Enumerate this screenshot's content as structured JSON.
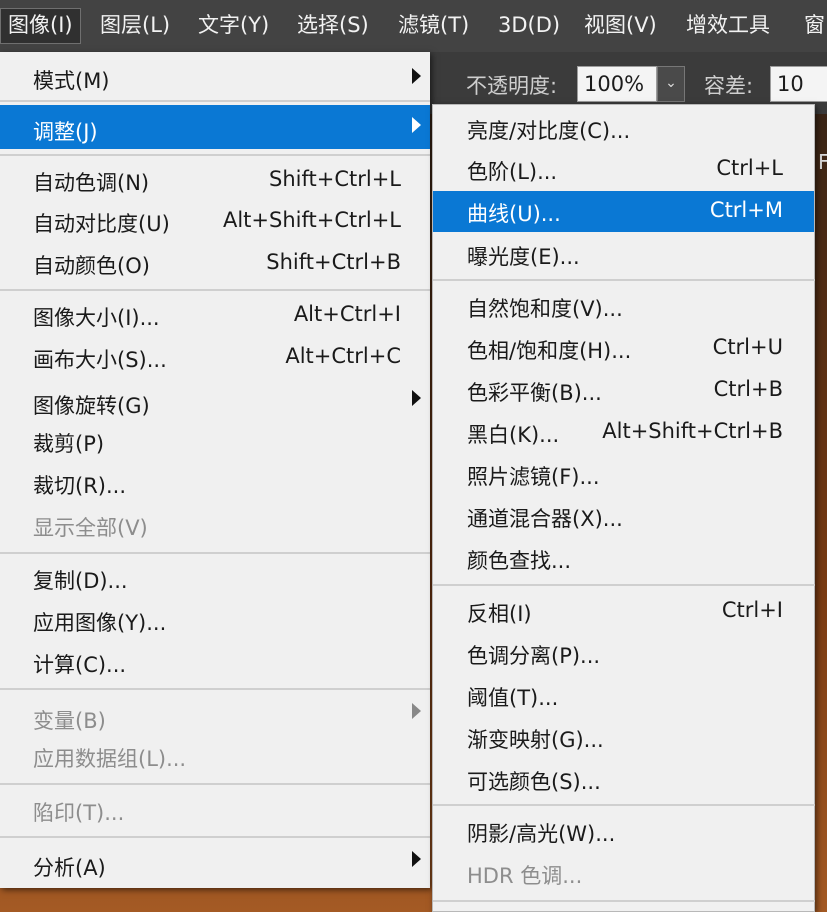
{
  "menubar": {
    "items": [
      "图像(I)",
      "图层(L)",
      "文字(Y)",
      "选择(S)",
      "滤镜(T)",
      "3D(D)",
      "视图(V)",
      "增效工具",
      "窗"
    ]
  },
  "options_bar": {
    "opacity_label": "不透明度:",
    "opacity_value": "100%",
    "tolerance_label": "容差:",
    "tolerance_value": "10",
    "right_fragment": "F"
  },
  "image_menu": {
    "items": [
      {
        "label": "模式(M)",
        "shortcut": "",
        "has_submenu": true,
        "disabled": false
      },
      {
        "label": "调整(J)",
        "shortcut": "",
        "has_submenu": true,
        "disabled": false,
        "active": true
      },
      {
        "label": "自动色调(N)",
        "shortcut": "Shift+Ctrl+L",
        "disabled": false
      },
      {
        "label": "自动对比度(U)",
        "shortcut": "Alt+Shift+Ctrl+L",
        "disabled": false
      },
      {
        "label": "自动颜色(O)",
        "shortcut": "Shift+Ctrl+B",
        "disabled": false
      },
      {
        "label": "图像大小(I)...",
        "shortcut": "Alt+Ctrl+I",
        "disabled": false
      },
      {
        "label": "画布大小(S)...",
        "shortcut": "Alt+Ctrl+C",
        "disabled": false
      },
      {
        "label": "图像旋转(G)",
        "shortcut": "",
        "has_submenu": true,
        "disabled": false
      },
      {
        "label": "裁剪(P)",
        "shortcut": "",
        "disabled": false
      },
      {
        "label": "裁切(R)...",
        "shortcut": "",
        "disabled": false
      },
      {
        "label": "显示全部(V)",
        "shortcut": "",
        "disabled": true
      },
      {
        "label": "复制(D)...",
        "shortcut": "",
        "disabled": false
      },
      {
        "label": "应用图像(Y)...",
        "shortcut": "",
        "disabled": false
      },
      {
        "label": "计算(C)...",
        "shortcut": "",
        "disabled": false
      },
      {
        "label": "变量(B)",
        "shortcut": "",
        "has_submenu": true,
        "disabled": true
      },
      {
        "label": "应用数据组(L)...",
        "shortcut": "",
        "disabled": true
      },
      {
        "label": "陷印(T)...",
        "shortcut": "",
        "disabled": true
      },
      {
        "label": "分析(A)",
        "shortcut": "",
        "has_submenu": true,
        "disabled": false
      }
    ]
  },
  "adjust_submenu": {
    "items": [
      {
        "label": "亮度/对比度(C)...",
        "shortcut": "",
        "disabled": false
      },
      {
        "label": "色阶(L)...",
        "shortcut": "Ctrl+L",
        "disabled": false
      },
      {
        "label": "曲线(U)...",
        "shortcut": "Ctrl+M",
        "disabled": false,
        "highlighted": true
      },
      {
        "label": "曝光度(E)...",
        "shortcut": "",
        "disabled": false
      },
      {
        "label": "自然饱和度(V)...",
        "shortcut": "",
        "disabled": false
      },
      {
        "label": "色相/饱和度(H)...",
        "shortcut": "Ctrl+U",
        "disabled": false
      },
      {
        "label": "色彩平衡(B)...",
        "shortcut": "Ctrl+B",
        "disabled": false
      },
      {
        "label": "黑白(K)...",
        "shortcut": "Alt+Shift+Ctrl+B",
        "disabled": false
      },
      {
        "label": "照片滤镜(F)...",
        "shortcut": "",
        "disabled": false
      },
      {
        "label": "通道混合器(X)...",
        "shortcut": "",
        "disabled": false
      },
      {
        "label": "颜色查找...",
        "shortcut": "",
        "disabled": false
      },
      {
        "label": "反相(I)",
        "shortcut": "Ctrl+I",
        "disabled": false
      },
      {
        "label": "色调分离(P)...",
        "shortcut": "",
        "disabled": false
      },
      {
        "label": "阈值(T)...",
        "shortcut": "",
        "disabled": false
      },
      {
        "label": "渐变映射(G)...",
        "shortcut": "",
        "disabled": false
      },
      {
        "label": "可选颜色(S)...",
        "shortcut": "",
        "disabled": false
      },
      {
        "label": "阴影/高光(W)...",
        "shortcut": "",
        "disabled": false
      },
      {
        "label": "HDR 色调...",
        "shortcut": "",
        "disabled": true
      }
    ]
  },
  "colors": {
    "highlight": "#0a78d4",
    "menu_bg": "#f0f0f0",
    "menubar_bg": "#434343",
    "disabled_text": "#8d8d8d"
  }
}
